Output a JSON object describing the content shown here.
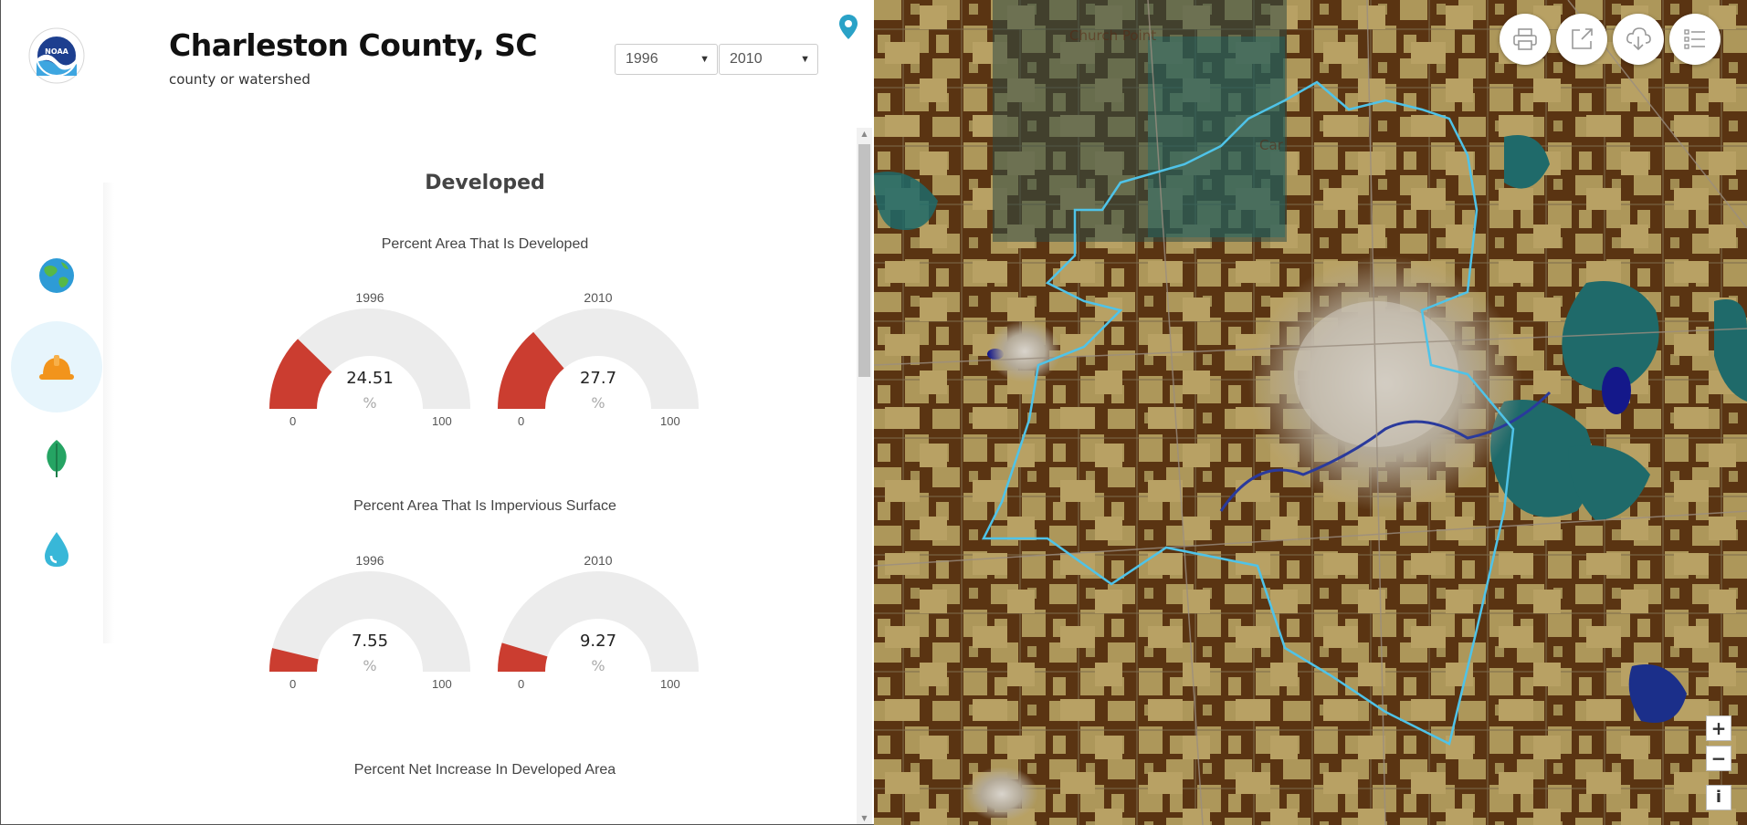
{
  "header": {
    "title": "Charleston County, SC",
    "subtitle": "county or watershed",
    "logo_text": "NOAA"
  },
  "year_selects": {
    "start": "1996",
    "end": "2010"
  },
  "nav": [
    {
      "icon": "globe-icon",
      "active": false
    },
    {
      "icon": "hard-hat-icon",
      "active": true
    },
    {
      "icon": "leaf-icon",
      "active": false
    },
    {
      "icon": "water-drop-icon",
      "active": false
    }
  ],
  "section": {
    "title": "Developed"
  },
  "charts": [
    {
      "title": "Percent Area That Is Developed",
      "gauges": [
        {
          "year": "1996",
          "value": "24.51",
          "fraction": 0.2451,
          "unit": "%",
          "min": "0",
          "max": "100"
        },
        {
          "year": "2010",
          "value": "27.7",
          "fraction": 0.277,
          "unit": "%",
          "min": "0",
          "max": "100"
        }
      ]
    },
    {
      "title": "Percent Area That Is Impervious Surface",
      "gauges": [
        {
          "year": "1996",
          "value": "7.55",
          "fraction": 0.0755,
          "unit": "%",
          "min": "0",
          "max": "100"
        },
        {
          "year": "2010",
          "value": "9.27",
          "fraction": 0.0927,
          "unit": "%",
          "min": "0",
          "max": "100"
        }
      ]
    },
    {
      "title": "Percent Net Increase In Developed Area"
    }
  ],
  "map": {
    "labels": [
      "Church Point",
      "Car"
    ],
    "tools": [
      "print-icon",
      "external-link-icon",
      "download-icon",
      "layers-list-icon"
    ],
    "zoom_in": "+",
    "zoom_out": "−",
    "info": "i"
  },
  "colors": {
    "gauge_fill": "#cb3d30",
    "gauge_track": "#ececec",
    "boundary": "#4fc3e8",
    "map_brown": "#5a3412",
    "map_tan": "#b09a5a",
    "map_teal": "#1f6a6a"
  }
}
